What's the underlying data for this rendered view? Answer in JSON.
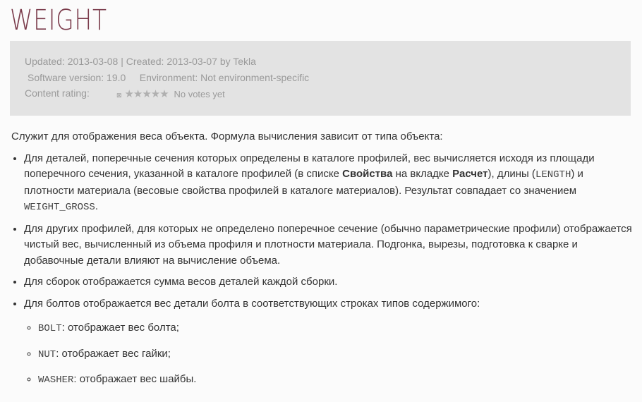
{
  "title": "WEIGHT",
  "meta": {
    "updated": "Updated: 2013-03-08 | Created: 2013-03-07 by Tekla",
    "software": "Software version:  19.0",
    "environment": "Environment:  Not environment-specific",
    "rating_label": "Content rating:",
    "stars": "★★★★★",
    "votes": "No votes yet"
  },
  "intro": "Служит для отображения веса объекта. Формула вычисления зависит от типа объекта:",
  "b1": {
    "t1": "Для деталей, поперечные сечения которых определены в каталоге профилей, вес вычисляется исходя из площади поперечного сечения, указанной в каталоге профилей (в списке ",
    "bold1": "Свойства",
    "t2": " на вкладке ",
    "bold2": "Расчет",
    "t3": "), длины (",
    "code1": "LENGTH",
    "t4": ") и плотности материала (весовые свойства профилей в каталоге материалов). Результат совпадает со значением ",
    "code2": "WEIGHT_GROSS",
    "t5": "."
  },
  "b2": "Для других профилей, для которых не определено поперечное сечение (обычно параметрические профили) отображается чистый вес, вычисленный из объема профиля и плотности материала. Подгонка, вырезы, подготовка к сварке и добавочные детали влияют на вычисление объема.",
  "b3": "Для сборок отображается сумма весов деталей каждой сборки.",
  "b4": "Для болтов отображается вес детали болта в соответствующих строках типов содержимого:",
  "sub": [
    {
      "code": "BOLT",
      "text": ": отображает вес болта;"
    },
    {
      "code": "NUT",
      "text": ": отображает вес гайки;"
    },
    {
      "code": "WASHER",
      "text": ": отображает вес шайбы."
    }
  ]
}
